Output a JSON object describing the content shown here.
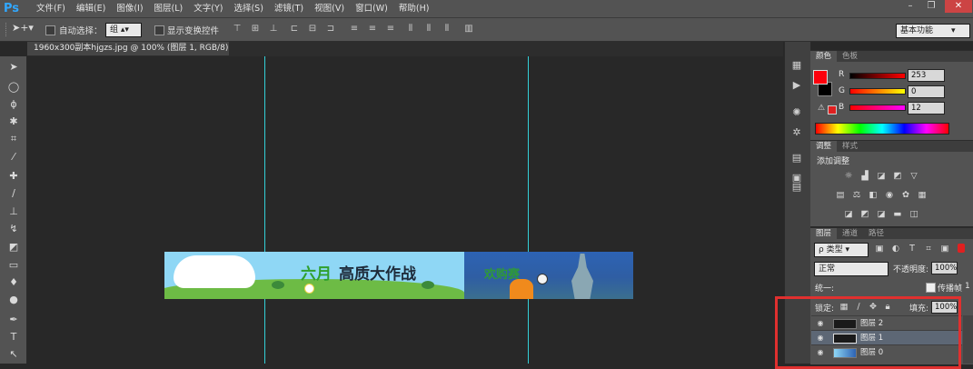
{
  "app": {
    "logo": "Ps"
  },
  "menu": [
    "文件(F)",
    "编辑(E)",
    "图像(I)",
    "图层(L)",
    "文字(Y)",
    "选择(S)",
    "滤镜(T)",
    "视图(V)",
    "窗口(W)",
    "帮助(H)"
  ],
  "window_controls": {
    "minimize": "–",
    "restore": "❐",
    "close": "✕"
  },
  "options": {
    "auto_select_label": "自动选择：",
    "auto_select_value": "组",
    "show_transform_label": "显示变换控件",
    "workspace": "基本功能"
  },
  "document_tab": {
    "title": "1960x300副本hjgzs.jpg @ 100% (图层 1, RGB/8) *",
    "close": "×"
  },
  "banner": {
    "headline_part1": "六月",
    "headline_part2": "高质大作战",
    "sub_text": "欢购赛"
  },
  "color_panel": {
    "tabs": [
      "颜色",
      "色板"
    ],
    "channels": [
      {
        "label": "R",
        "value": "253"
      },
      {
        "label": "G",
        "value": "0"
      },
      {
        "label": "B",
        "value": "12"
      }
    ],
    "foreground": "#fd000c",
    "background": "#000000"
  },
  "adjust_panel": {
    "tabs": [
      "调整",
      "样式"
    ],
    "title": "添加调整"
  },
  "layers_panel": {
    "tabs": [
      "图层",
      "通道",
      "路径"
    ],
    "filter_kind": "ρ 类型",
    "blend_mode": "正常",
    "opacity_label": "不透明度:",
    "opacity_value": "100%",
    "unify_label": "统一:",
    "propagate_label": "传播帧",
    "propagate_value": "1",
    "lock_label": "锁定:",
    "fill_label": "填充:",
    "fill_value": "100%",
    "layers": [
      {
        "name": "图层 2",
        "selected": false
      },
      {
        "name": "图层 1",
        "selected": true
      },
      {
        "name": "图层 0",
        "selected": false
      }
    ]
  },
  "colors": {
    "guide": "#33d0d8",
    "highlight": "#e0302f",
    "banner_green": "#2fa02d"
  }
}
